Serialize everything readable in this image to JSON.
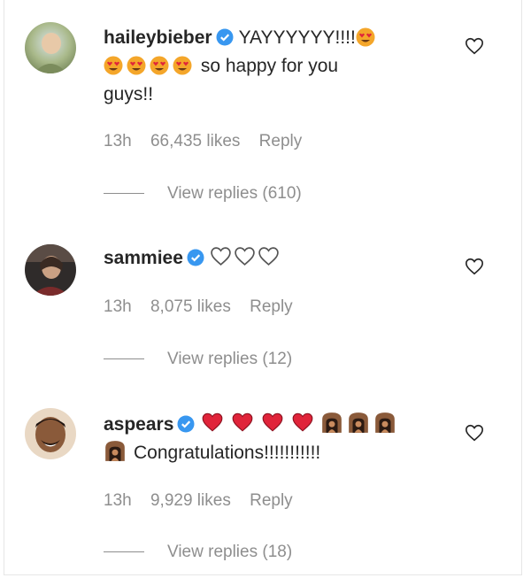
{
  "comments": [
    {
      "username": "haileybieber",
      "text_part1": "YAYYYYYY!!!!",
      "text_part2": "so happy for you",
      "text_part3": "guys!!",
      "time": "13h",
      "likes": "66,435 likes",
      "reply": "Reply",
      "view_replies": "View replies (610)"
    },
    {
      "username": "sammiee",
      "time": "13h",
      "likes": "8,075 likes",
      "reply": "Reply",
      "view_replies": "View replies (12)"
    },
    {
      "username": "aspears",
      "text": "Congratulations!!!!!!!!!!!",
      "time": "13h",
      "likes": "9,929 likes",
      "reply": "Reply",
      "view_replies": "View replies (18)"
    }
  ],
  "colors": {
    "verified": "#3897f0",
    "heart_red": "#e0243a",
    "emoji_face": "#f4a62a",
    "meta_gray": "#8e8e8e"
  },
  "icons": {
    "verified": "verified-badge-icon",
    "like": "heart-outline-icon",
    "heart_eyes": "heart-eyes-emoji",
    "white_heart": "white-heart-emoji",
    "red_heart": "red-heart-emoji",
    "family": "family-emoji"
  }
}
